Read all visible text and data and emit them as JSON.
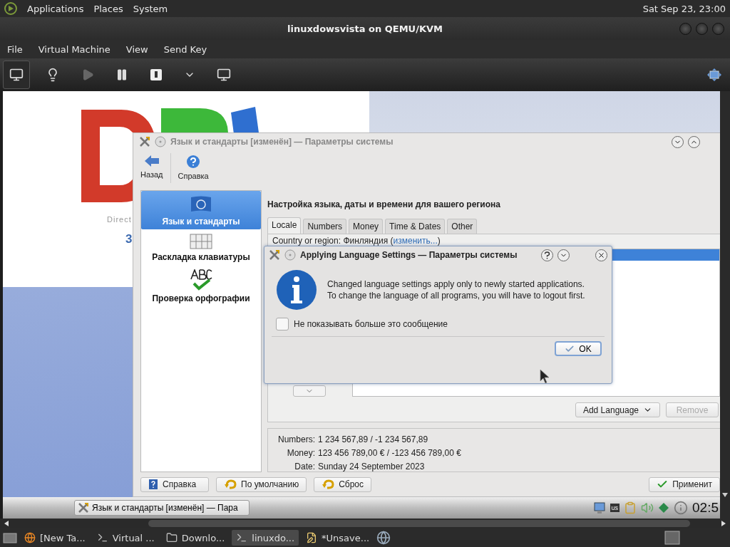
{
  "top_panel": {
    "menus": [
      "Applications",
      "Places",
      "System"
    ],
    "clock": "Sat Sep 23, 23:00"
  },
  "vm_window": {
    "title": "linuxdowsvista on QEMU/KVM",
    "menu": [
      "File",
      "Virtual Machine",
      "View",
      "Send Key"
    ]
  },
  "guest": {
    "logo_text": "Direct",
    "logo_fragment": "3",
    "settings_window": {
      "title": "Язык и стандарты [изменён] — Параметры системы",
      "toolbar": [
        {
          "label": "Назад",
          "kind": "back"
        },
        {
          "label": "Справка",
          "kind": "help"
        }
      ],
      "sidebar": [
        {
          "label": "Язык и стандарты",
          "selected": true,
          "kind": "flag"
        },
        {
          "label": "Раскладка клавиатуры",
          "selected": false,
          "kind": "keyboard"
        },
        {
          "label": "Проверка орфографии",
          "selected": false,
          "kind": "spelling"
        }
      ],
      "heading": "Настройка языка, даты и времени для вашего региона",
      "tabs": [
        {
          "label": "Locale",
          "selected": true
        },
        {
          "label": "Numbers",
          "selected": false
        },
        {
          "label": "Money",
          "selected": false
        },
        {
          "label": "Time & Dates",
          "selected": false
        },
        {
          "label": "Other",
          "selected": false
        }
      ],
      "country": {
        "label": "Country or region: Финляндия (",
        "link": "изменить...",
        "end": ")"
      },
      "add_language": "Add Language",
      "remove": {
        "label": "Remove",
        "disabled": true
      },
      "examples": [
        {
          "label": "Numbers:",
          "value": "1 234 567,89 / -1 234 567,89"
        },
        {
          "label": "Money:",
          "value": "123 456 789,00 € / -123 456 789,00 €"
        },
        {
          "label": "Date:",
          "value": "Sunday 24 September 2023"
        }
      ],
      "buttons": [
        {
          "label": "Справка",
          "kind": "help"
        },
        {
          "label": "По умолчанию",
          "kind": "defaults"
        },
        {
          "label": "Сброс",
          "kind": "reset"
        },
        {
          "label": "Применит",
          "kind": "apply"
        }
      ]
    },
    "dialog": {
      "title": "Applying Language Settings — Параметры системы",
      "message": [
        "Changed language settings apply only to newly started applications.",
        "To change the language of all programs, you will have to logout first."
      ],
      "checkbox": {
        "label": "Не показывать больше это сообщение",
        "checked": false
      },
      "ok": "OK"
    },
    "taskbar": {
      "task": "Язык и стандарты [изменён] — Пара",
      "keyboard": "us",
      "clock": "02:5"
    }
  },
  "host_taskbar": [
    {
      "label": "[New Ta...",
      "kind": "browser",
      "selected": false
    },
    {
      "label": "Virtual ...",
      "kind": "terminal",
      "selected": false
    },
    {
      "label": "Downlo...",
      "kind": "folder",
      "selected": false
    },
    {
      "label": "linuxdo...",
      "kind": "terminal",
      "selected": true
    },
    {
      "label": "*Unsave...",
      "kind": "editor",
      "selected": false
    }
  ]
}
